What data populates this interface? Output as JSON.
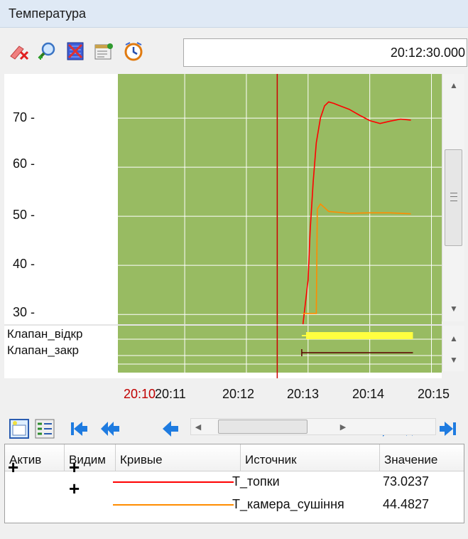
{
  "window": {
    "title": "Температура"
  },
  "toolbar": {
    "timestamp": "20:12:30.000",
    "icons": [
      "delete-icon",
      "zoom-in-icon",
      "clear-icon",
      "properties-icon",
      "time-icon"
    ]
  },
  "chart": {
    "y_ticks": [
      "70 -",
      "60 -",
      "50 -",
      "40 -",
      "30 -"
    ],
    "x_ticks": [
      "20:10",
      "20:11",
      "20:12",
      "20:13",
      "20:14",
      "20:15"
    ],
    "digital_labels": [
      "Клапан_відкр",
      "Клапан_закр"
    ],
    "colors": {
      "background": "#98bb62",
      "cursor": "#cc0000",
      "t_topky": "#ff0000",
      "t_kamera": "#ff8c00",
      "klapan_vidkr": "#ffff40",
      "klapan_zakr": "#5a0000"
    }
  },
  "chart_data": {
    "type": "line",
    "xlabel": "",
    "ylabel": "",
    "ylim": [
      28,
      79
    ],
    "xlim": [
      "20:09:55",
      "20:15:10"
    ],
    "cursor_x": "20:12:30",
    "series": [
      {
        "name": "T_топки",
        "color": "#ff0000",
        "x": [
          "20:12:55",
          "20:13:00",
          "20:13:02",
          "20:13:05",
          "20:13:08",
          "20:13:12",
          "20:13:16",
          "20:13:20",
          "20:13:25",
          "20:13:30",
          "20:13:40",
          "20:13:50",
          "20:14:00",
          "20:14:10",
          "20:14:20",
          "20:14:30",
          "20:14:40"
        ],
        "y": [
          28,
          37,
          47,
          57,
          65,
          70,
          72.5,
          73.3,
          73.0,
          72.6,
          71.8,
          70.6,
          69.5,
          68.9,
          69.4,
          69.8,
          69.6
        ]
      },
      {
        "name": "T_камера_сушіння",
        "color": "#ff8c00",
        "x": [
          "20:12:55",
          "20:13:08",
          "20:13:09",
          "20:13:12",
          "20:13:20",
          "20:13:40",
          "20:14:00",
          "20:14:20",
          "20:14:40"
        ],
        "y": [
          30.2,
          30.2,
          51.5,
          52.5,
          51.0,
          50.6,
          50.7,
          50.7,
          50.5
        ]
      }
    ]
  },
  "navbar": {
    "icons": [
      "chart-settings-icon",
      "legend-icon",
      "first-icon",
      "fast-back-icon",
      "back-icon",
      "forward-icon",
      "fast-forward-icon",
      "last-icon"
    ]
  },
  "table": {
    "headers": [
      "Актив",
      "Видим",
      "Кривые",
      "Источник",
      "Значение"
    ],
    "rows": [
      {
        "active": "+",
        "visible": "+",
        "color": "#ff0000",
        "source": "T_топки",
        "value": "73.0237"
      },
      {
        "active": "",
        "visible": "+",
        "color": "#ff8c00",
        "source": "T_камера_сушіння",
        "value": "44.4827"
      }
    ]
  }
}
